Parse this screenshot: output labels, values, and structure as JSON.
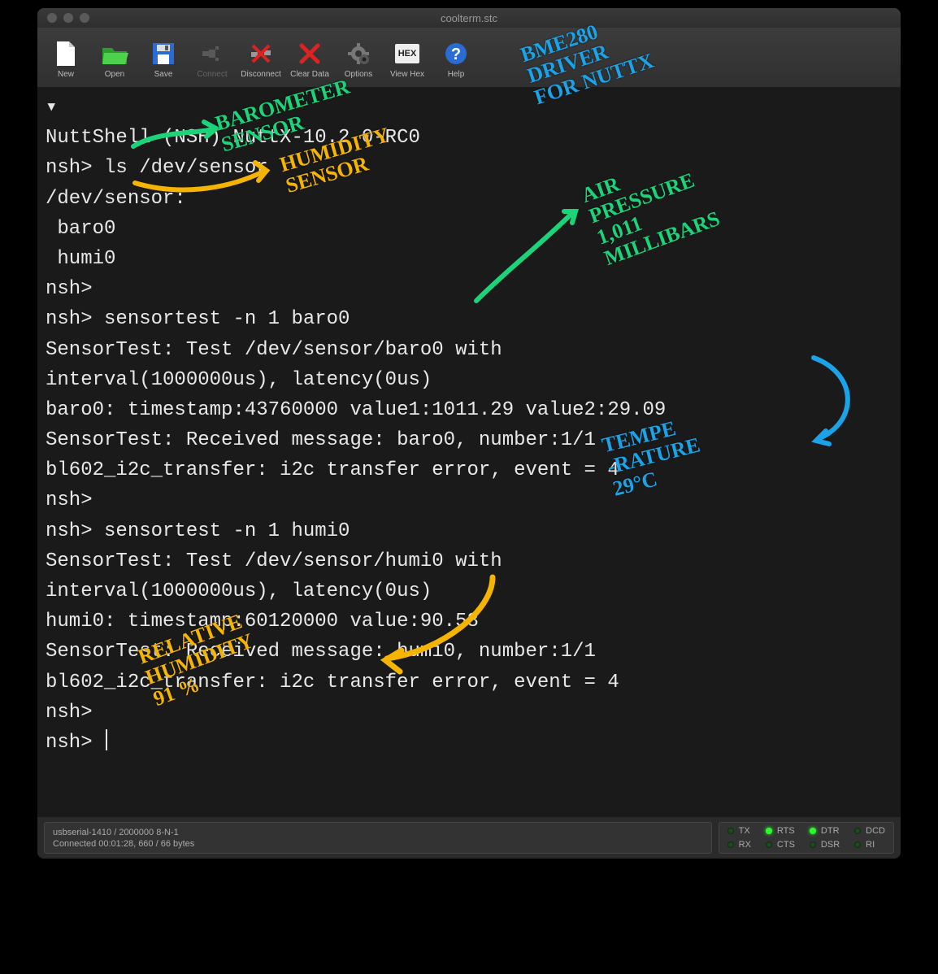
{
  "window": {
    "title": "coolterm.stc"
  },
  "toolbar": [
    {
      "id": "new",
      "label": "New",
      "icon": "new"
    },
    {
      "id": "open",
      "label": "Open",
      "icon": "open"
    },
    {
      "id": "save",
      "label": "Save",
      "icon": "save"
    },
    {
      "id": "connect",
      "label": "Connect",
      "icon": "connect",
      "disabled": true
    },
    {
      "id": "disconnect",
      "label": "Disconnect",
      "icon": "disconnect"
    },
    {
      "id": "clear",
      "label": "Clear Data",
      "icon": "clear"
    },
    {
      "id": "options",
      "label": "Options",
      "icon": "options"
    },
    {
      "id": "viewhex",
      "label": "View Hex",
      "icon": "hex"
    },
    {
      "id": "help",
      "label": "Help",
      "icon": "help"
    }
  ],
  "terminal_lines": [
    "▾",
    "NuttShell (NSH) NuttX-10.2.0-RC0",
    "nsh> ls /dev/sensor",
    "/dev/sensor:",
    " baro0",
    " humi0",
    "nsh>",
    "nsh> sensortest -n 1 baro0",
    "SensorTest: Test /dev/sensor/baro0 with",
    "interval(1000000us), latency(0us)",
    "baro0: timestamp:43760000 value1:1011.29 value2:29.09",
    "SensorTest: Received message: baro0, number:1/1",
    "bl602_i2c_transfer: i2c transfer error, event = 4",
    "nsh>",
    "nsh> sensortest -n 1 humi0",
    "SensorTest: Test /dev/sensor/humi0 with",
    "interval(1000000us), latency(0us)",
    "humi0: timestamp:60120000 value:90.58",
    "SensorTest: Received message: humi0, number:1/1",
    "bl602_i2c_transfer: i2c transfer error, event = 4",
    "nsh>",
    "nsh> "
  ],
  "status": {
    "line1": "usbserial-1410 / 2000000 8-N-1",
    "line2": "Connected 00:01:28, 660 / 66 bytes",
    "leds": [
      {
        "name": "TX",
        "on": false
      },
      {
        "name": "RTS",
        "on": true
      },
      {
        "name": "DTR",
        "on": true
      },
      {
        "name": "DCD",
        "on": false
      },
      {
        "name": "RX",
        "on": false
      },
      {
        "name": "CTS",
        "on": false
      },
      {
        "name": "DSR",
        "on": false
      },
      {
        "name": "RI",
        "on": false
      }
    ]
  },
  "annotations": {
    "bme": "BME280\nDRIVER\nFOR NUTTX",
    "baro": "BAROMETER\nSENSOR",
    "humi": "HUMIDITY\nSENSOR",
    "pressure": "AIR\nPRESSURE\n1,011\nMILLIBARS",
    "temp": "TEMPE\n-RATURE\n29°C",
    "relhumi": "RELATIVE\nHUMIDITY\n91 %"
  }
}
